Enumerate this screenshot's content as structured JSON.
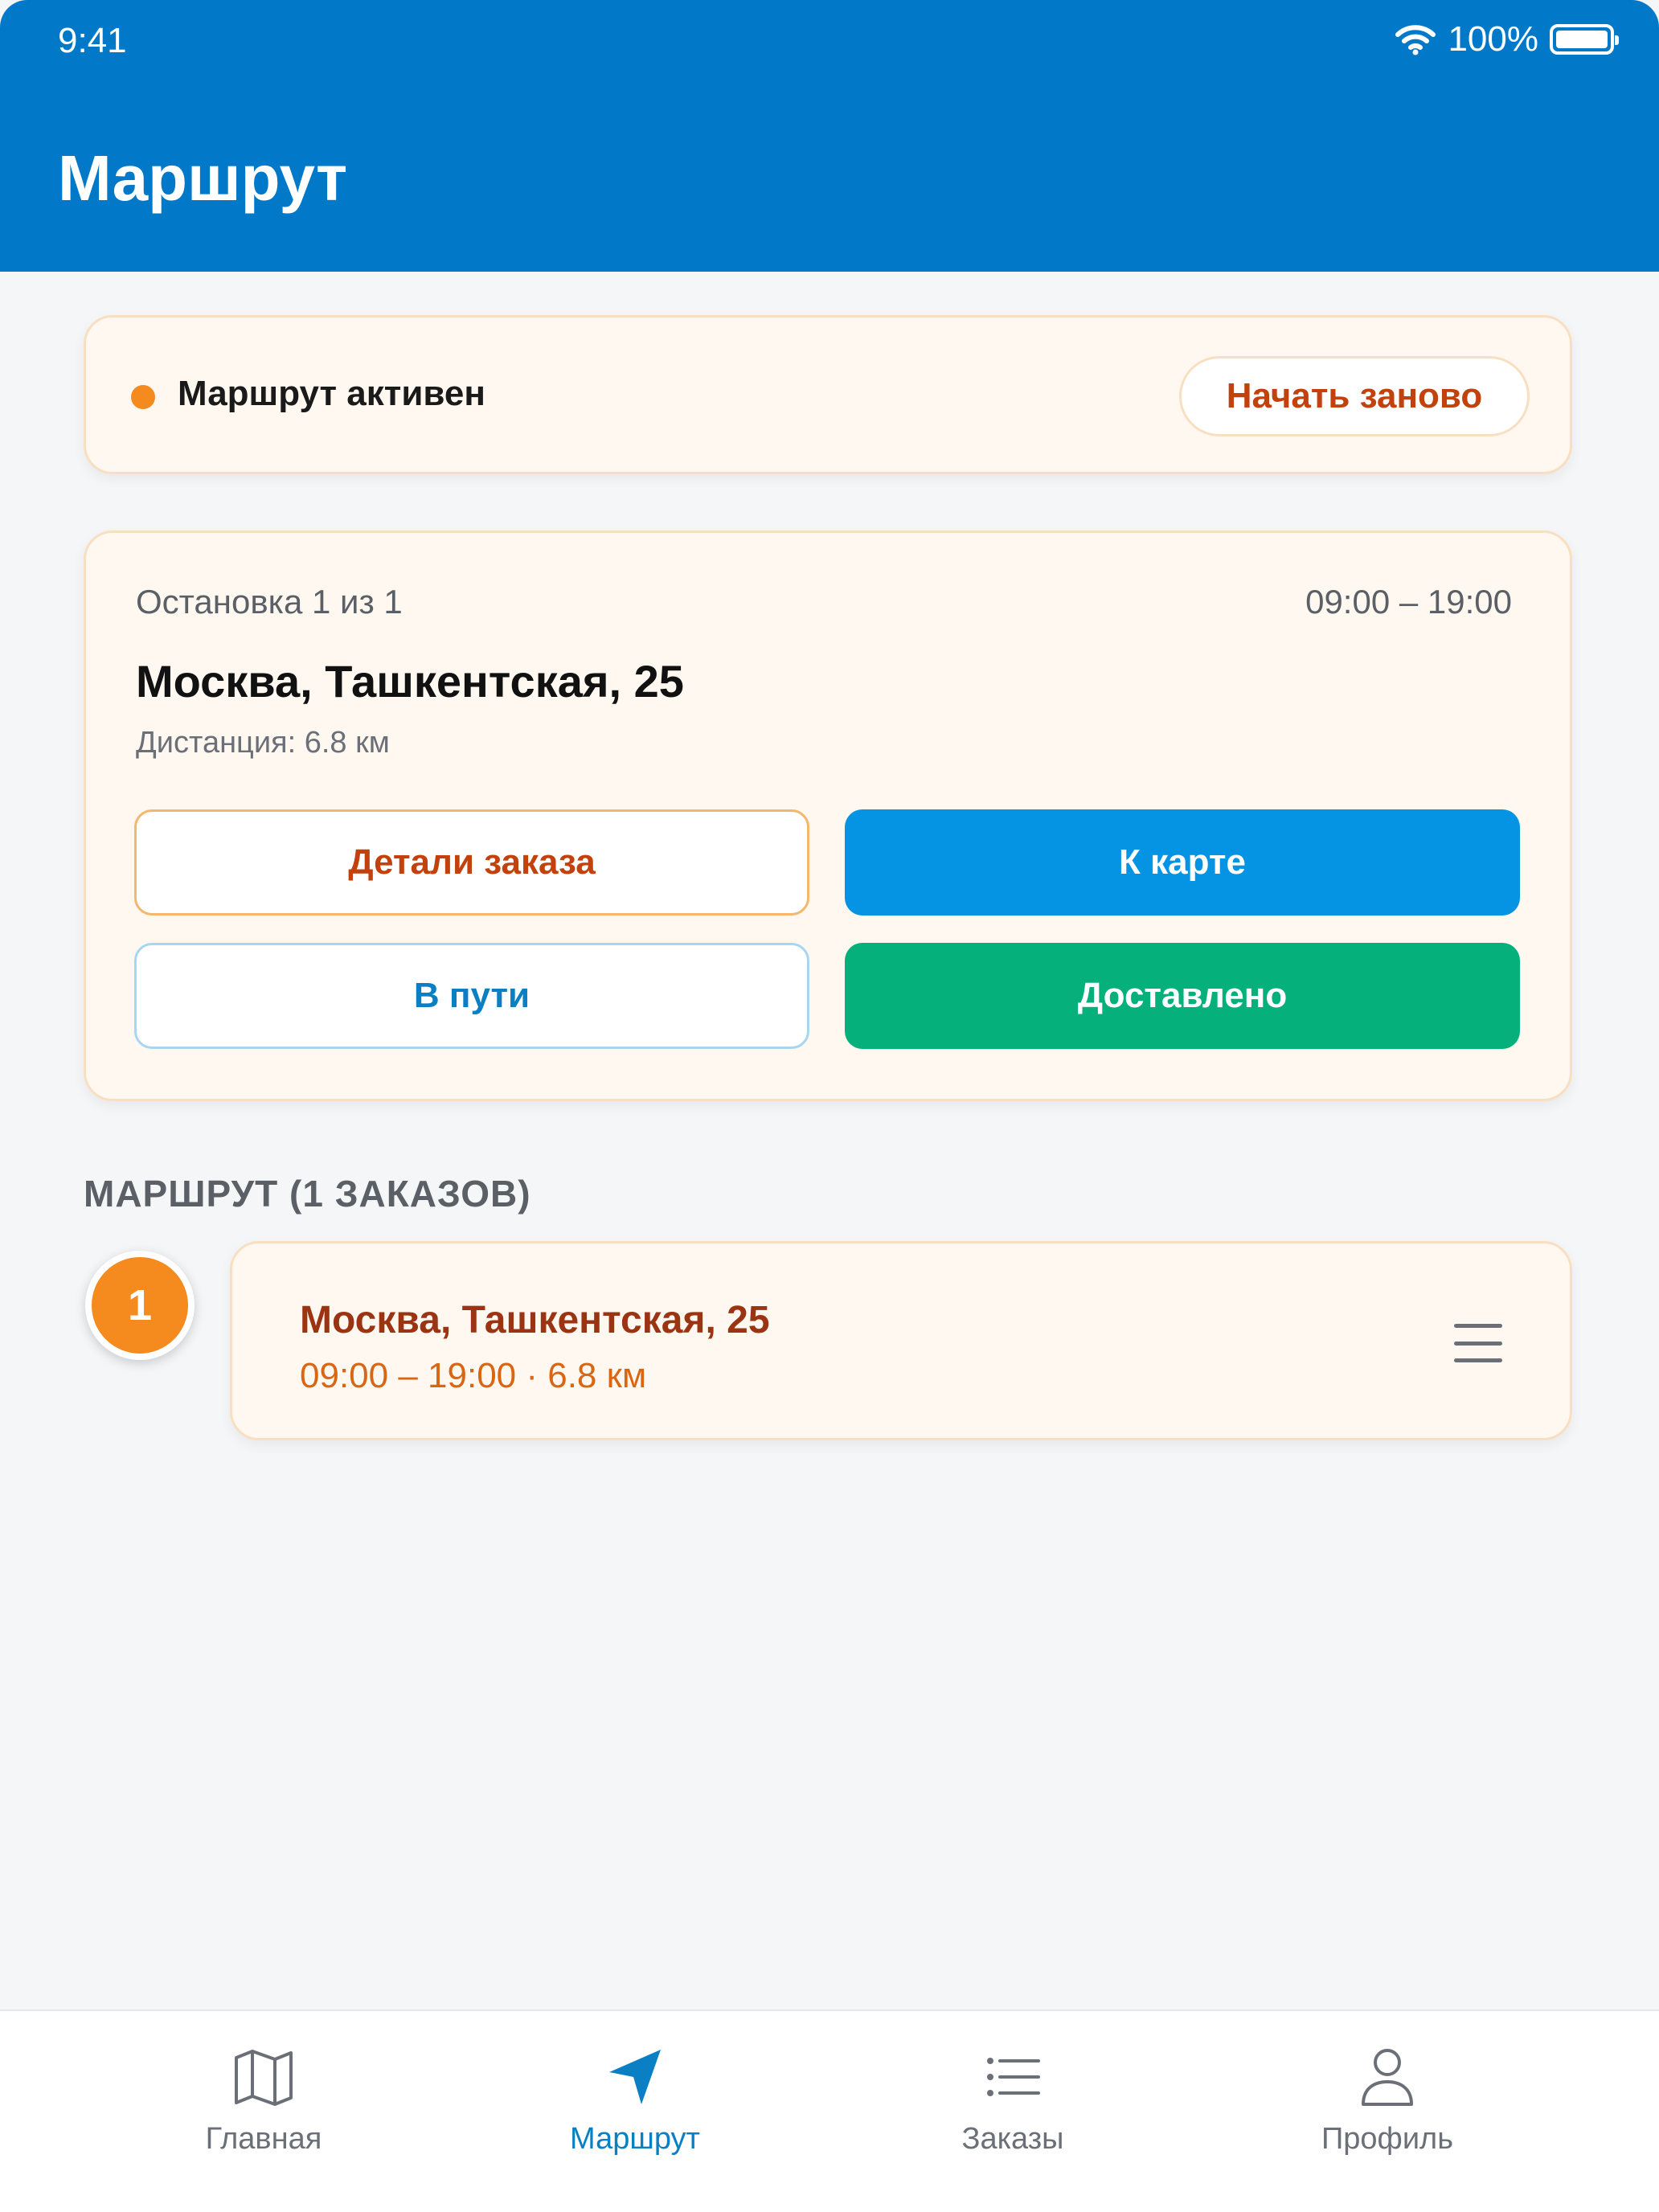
{
  "status_bar": {
    "time": "9:41",
    "battery": "100%"
  },
  "header": {
    "title": "Маршрут"
  },
  "route_status": {
    "text": "Маршрут активен",
    "restart_label": "Начать заново"
  },
  "current_stop": {
    "progress": "Остановка 1 из 1",
    "time_window": "09:00 – 19:00",
    "address": "Москва, Ташкентская, 25",
    "distance": "Дистанция: 6.8 км",
    "buttons": {
      "details": "Детали заказа",
      "map": "К карте",
      "in_transit": "В пути",
      "delivered": "Доставлено"
    }
  },
  "route_list": {
    "title": "МАРШРУТ (1 ЗАКАЗОВ)",
    "items": [
      {
        "number": "1",
        "address": "Москва, Ташкентская, 25",
        "details": "09:00 – 19:00 · 6.8 км"
      }
    ]
  },
  "tabbar": {
    "tabs": [
      {
        "label": "Главная",
        "icon": "map-icon"
      },
      {
        "label": "Маршрут",
        "icon": "navigation-arrow-icon",
        "active": true
      },
      {
        "label": "Заказы",
        "icon": "list-icon"
      },
      {
        "label": "Профиль",
        "icon": "user-icon"
      }
    ]
  },
  "colors": {
    "header": "#0179c8",
    "accent_orange": "#f58a1f",
    "primary_blue": "#0494e3",
    "success_green": "#05b07a"
  }
}
